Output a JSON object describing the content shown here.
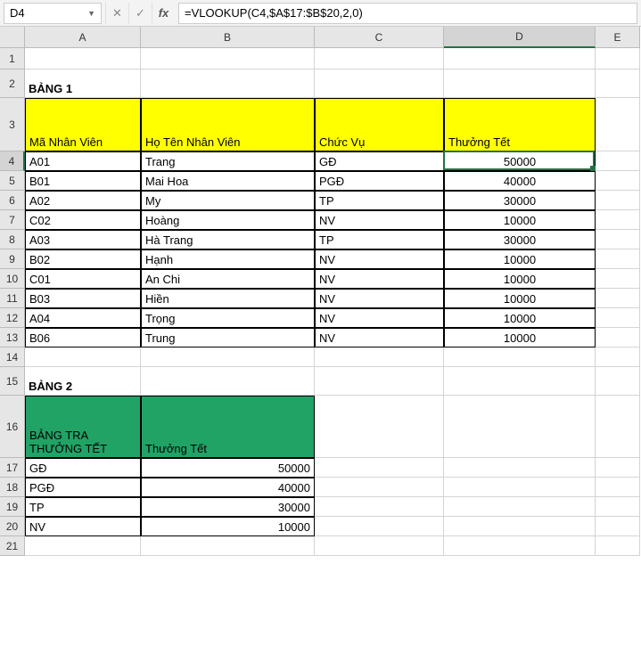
{
  "name_box": "D4",
  "formula": "=VLOOKUP(C4,$A$17:$B$20,2,0)",
  "fx_label": "fx",
  "cols": {
    "A": 130,
    "B": 195,
    "C": 145,
    "D": 170,
    "E": 50
  },
  "row_heights": {
    "1": 24,
    "2": 32,
    "3": 60,
    "4": 22,
    "5": 22,
    "6": 22,
    "7": 22,
    "8": 22,
    "9": 22,
    "10": 22,
    "11": 22,
    "12": 22,
    "13": 22,
    "14": 22,
    "15": 32,
    "16": 70,
    "17": 22,
    "18": 22,
    "19": 22,
    "20": 22,
    "21": 22
  },
  "titles": {
    "bang1": "BẢNG 1",
    "bang2": "BẢNG 2"
  },
  "bang1_headers": {
    "a": "Mã Nhân Viên",
    "b": "Họ Tên Nhân Viên",
    "c": "Chức Vụ",
    "d": "Thưởng Tết"
  },
  "bang1_rows": [
    {
      "ma": "A01",
      "ho": "Trang",
      "cv": "GĐ",
      "th": "50000"
    },
    {
      "ma": "B01",
      "ho": "Mai Hoa",
      "cv": "PGĐ",
      "th": "40000"
    },
    {
      "ma": "A02",
      "ho": "My",
      "cv": "TP",
      "th": "30000"
    },
    {
      "ma": "C02",
      "ho": "Hoàng",
      "cv": "NV",
      "th": "10000"
    },
    {
      "ma": "A03",
      "ho": "Hà Trang",
      "cv": "TP",
      "th": "30000"
    },
    {
      "ma": "B02",
      "ho": "Hạnh",
      "cv": "NV",
      "th": "10000"
    },
    {
      "ma": "C01",
      "ho": "An Chi",
      "cv": "NV",
      "th": "10000"
    },
    {
      "ma": "B03",
      "ho": "Hiền",
      "cv": "NV",
      "th": "10000"
    },
    {
      "ma": "A04",
      "ho": "Trọng",
      "cv": "NV",
      "th": "10000"
    },
    {
      "ma": "B06",
      "ho": "Trung",
      "cv": "NV",
      "th": "10000"
    }
  ],
  "bang2_headers": {
    "a": "BẢNG TRA THƯỞNG TẾT",
    "b": "Thưởng Tết"
  },
  "bang2_rows": [
    {
      "cv": "GĐ",
      "th": "50000"
    },
    {
      "cv": "PGĐ",
      "th": "40000"
    },
    {
      "cv": "TP",
      "th": "30000"
    },
    {
      "cv": "NV",
      "th": "10000"
    }
  ],
  "chart_data": {
    "type": "table",
    "tables": [
      {
        "name": "BẢNG 1",
        "columns": [
          "Mã Nhân Viên",
          "Họ Tên Nhân Viên",
          "Chức Vụ",
          "Thưởng Tết"
        ],
        "rows": [
          [
            "A01",
            "Trang",
            "GĐ",
            50000
          ],
          [
            "B01",
            "Mai Hoa",
            "PGĐ",
            40000
          ],
          [
            "A02",
            "My",
            "TP",
            30000
          ],
          [
            "C02",
            "Hoàng",
            "NV",
            10000
          ],
          [
            "A03",
            "Hà Trang",
            "TP",
            30000
          ],
          [
            "B02",
            "Hạnh",
            "NV",
            10000
          ],
          [
            "C01",
            "An Chi",
            "NV",
            10000
          ],
          [
            "B03",
            "Hiền",
            "NV",
            10000
          ],
          [
            "A04",
            "Trọng",
            "NV",
            10000
          ],
          [
            "B06",
            "Trung",
            "NV",
            10000
          ]
        ]
      },
      {
        "name": "BẢNG 2",
        "columns": [
          "BẢNG TRA THƯỞNG TẾT",
          "Thưởng Tết"
        ],
        "rows": [
          [
            "GĐ",
            50000
          ],
          [
            "PGĐ",
            40000
          ],
          [
            "TP",
            30000
          ],
          [
            "NV",
            10000
          ]
        ]
      }
    ]
  }
}
